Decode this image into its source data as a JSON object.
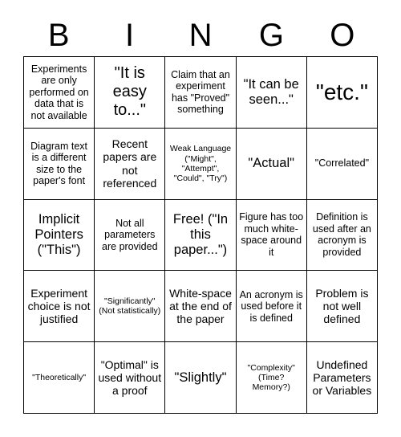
{
  "card": {
    "title": "BINGO",
    "header": [
      "B",
      "I",
      "N",
      "G",
      "O"
    ],
    "rows": [
      [
        {
          "text": "Experiments are only performed on data that is not available",
          "size": "s"
        },
        {
          "text": "\"It is easy to...\"",
          "size": "xl"
        },
        {
          "text": "Claim that an experiment has \"Proved\" something",
          "size": "s"
        },
        {
          "text": "\"It can be seen...\"",
          "size": "l"
        },
        {
          "text": "\"etc.\"",
          "size": "xxl"
        }
      ],
      [
        {
          "text": "Diagram text is a different size to the paper's font",
          "size": "s"
        },
        {
          "text": "Recent papers are not referenced",
          "size": "m"
        },
        {
          "text": "Weak Language (\"Might\", \"Attempt\", \"Could\", \"Try\")",
          "size": "xs"
        },
        {
          "text": "\"Actual\"",
          "size": "l"
        },
        {
          "text": "\"Correlated\"",
          "size": "s"
        }
      ],
      [
        {
          "text": "Implicit Pointers (\"This\")",
          "size": "l"
        },
        {
          "text": "Not all parameters are provided",
          "size": "s"
        },
        {
          "text": "Free! (\"In this paper...\")",
          "size": "l"
        },
        {
          "text": "Figure has too much white-space around it",
          "size": "s"
        },
        {
          "text": "Definition is used after an acronym is provided",
          "size": "s"
        }
      ],
      [
        {
          "text": "Experiment choice is not justified",
          "size": "m"
        },
        {
          "text": "\"Significantly\" (Not statistically)",
          "size": "xs"
        },
        {
          "text": "White-space at the end of the paper",
          "size": "m"
        },
        {
          "text": "An acronym is used before it is defined",
          "size": "s"
        },
        {
          "text": "Problem is not well defined",
          "size": "m"
        }
      ],
      [
        {
          "text": "\"Theoretically\"",
          "size": "xs"
        },
        {
          "text": "\"Optimal\" is used without a proof",
          "size": "m"
        },
        {
          "text": "\"Slightly\"",
          "size": "l"
        },
        {
          "text": "\"Complexity\" (Time? Memory?)",
          "size": "xs"
        },
        {
          "text": "Undefined Parameters or Variables",
          "size": "m"
        }
      ]
    ]
  },
  "colors": {
    "background": "#ffffff",
    "text": "#000000",
    "border": "#000000"
  }
}
